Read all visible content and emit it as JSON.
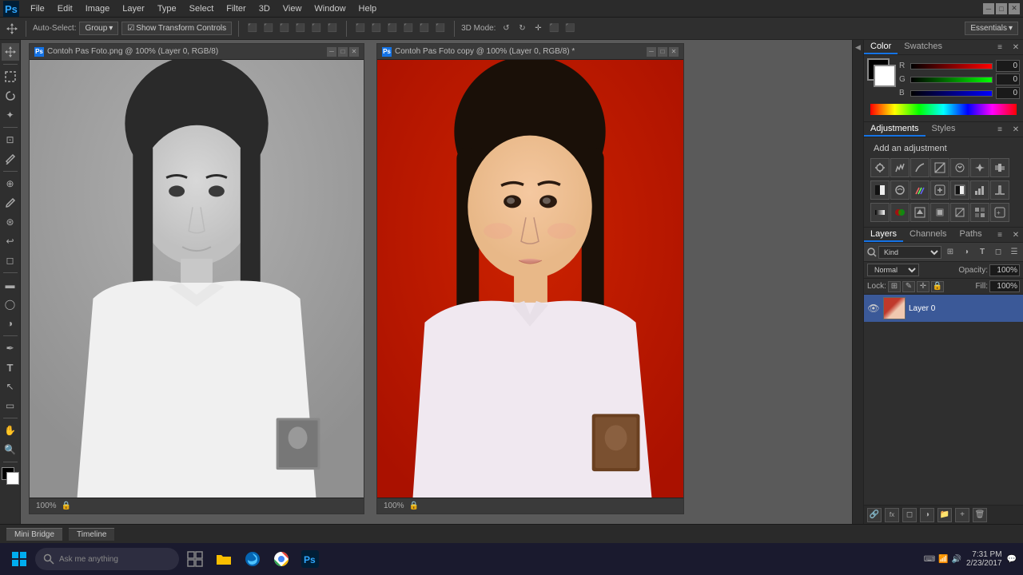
{
  "app": {
    "title": "Adobe Photoshop",
    "logo": "Ps"
  },
  "menu": {
    "items": [
      "File",
      "Edit",
      "Image",
      "Layer",
      "Type",
      "Select",
      "Filter",
      "3D",
      "View",
      "Window",
      "Help"
    ]
  },
  "toolbar": {
    "auto_select_label": "Auto-Select:",
    "auto_select_value": "Group",
    "show_transform_label": "Show Transform Controls",
    "mode_label": "3D Mode:",
    "workspace": "Essentials"
  },
  "documents": [
    {
      "id": "doc1",
      "title": "Contoh Pas Foto.png @ 100% (Layer 0, RGB/8)",
      "zoom": "100%",
      "type": "grayscale"
    },
    {
      "id": "doc2",
      "title": "Contoh Pas Foto copy @ 100% (Layer 0, RGB/8) *",
      "zoom": "100%",
      "type": "color"
    }
  ],
  "color_panel": {
    "tab_color": "Color",
    "tab_swatches": "Swatches",
    "r_label": "R",
    "g_label": "G",
    "b_label": "B",
    "r_value": "0",
    "g_value": "0",
    "b_value": "0"
  },
  "adjustments_panel": {
    "title": "Add an adjustment",
    "tab": "Adjustments",
    "tab2": "Styles"
  },
  "layers_panel": {
    "tab": "Layers",
    "tab2": "Channels",
    "tab3": "Paths",
    "filter_label": "Kind",
    "mode_value": "Normal",
    "opacity_label": "Opacity:",
    "opacity_value": "100%",
    "fill_label": "Fill:",
    "fill_value": "100%",
    "lock_label": "Lock:",
    "layer_name": "Layer 0"
  },
  "status_bar": {
    "tabs": [
      "Mini Bridge",
      "Timeline"
    ]
  },
  "taskbar": {
    "search_placeholder": "Ask me anything",
    "time": "7:31 PM",
    "date": "2/23/2017",
    "icons": [
      "windows",
      "search",
      "task-view",
      "file-explorer",
      "edge",
      "chrome-icon",
      "photoshop-icon"
    ]
  },
  "tools": [
    "move",
    "marquee",
    "lasso",
    "magic-wand",
    "crop",
    "eyedropper",
    "healing",
    "brush",
    "clone",
    "history",
    "eraser",
    "gradient",
    "blur",
    "dodge",
    "pen",
    "text",
    "path-selection",
    "shape",
    "hand",
    "zoom"
  ],
  "foreground_color": "#000000",
  "background_color": "#ffffff"
}
